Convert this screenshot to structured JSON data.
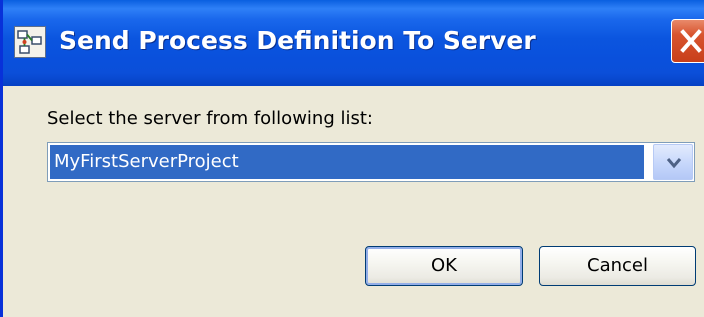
{
  "window": {
    "title": "Send Process Definition To Server",
    "title_icon": "process-definition-icon",
    "close_icon": "close-icon"
  },
  "dialog": {
    "prompt": "Select the server from following list:",
    "server_select": {
      "selected": "MyFirstServerProject",
      "arrow_icon": "chevron-down-icon"
    },
    "buttons": {
      "ok_label": "OK",
      "cancel_label": "Cancel"
    }
  },
  "colors": {
    "titlebar": "#0a50dc",
    "selection": "#316ac5",
    "close_button": "#d8542e"
  }
}
